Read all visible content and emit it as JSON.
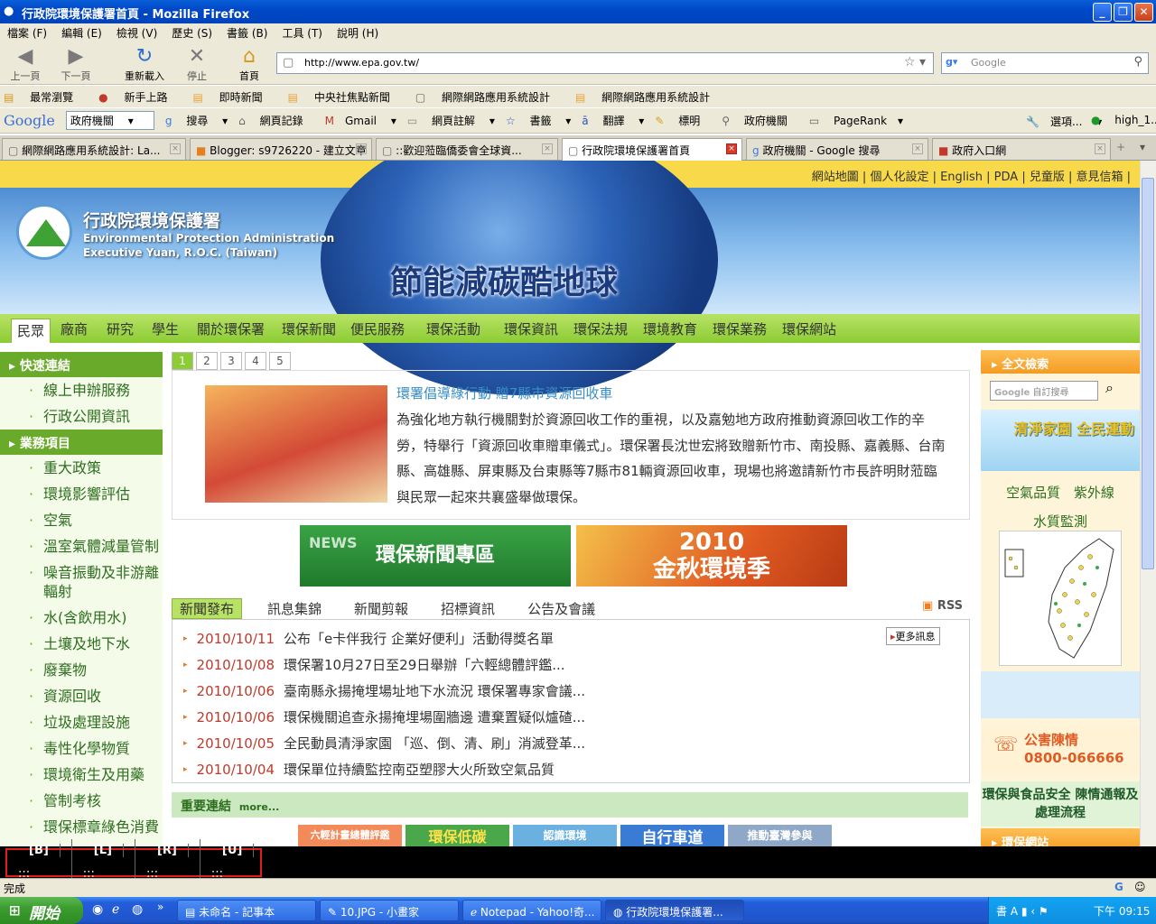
{
  "window": {
    "title": "行政院環境保護署首頁 - Mozilla Firefox"
  },
  "menu": [
    "檔案 (F)",
    "編輯 (E)",
    "檢視 (V)",
    "歷史 (S)",
    "書籤 (B)",
    "工具 (T)",
    "說明 (H)"
  ],
  "nav": {
    "back": "上一頁",
    "forward": "下一頁",
    "reload": "重新載入",
    "stop": "停止",
    "home": "首頁"
  },
  "address": {
    "url": "http://www.epa.gov.tw/"
  },
  "search": {
    "placeholder": "Google"
  },
  "bookmarks": [
    "最常瀏覽",
    "新手上路",
    "即時新聞",
    "中央社焦點新聞",
    "網際網路應用系統設計",
    "網際網路應用系統設計"
  ],
  "googlebar": {
    "logo": "Google",
    "select_value": "政府機關",
    "items": [
      "搜尋",
      "網頁記錄",
      "Gmail",
      "網頁註解",
      "書籤",
      "翻譯",
      "標明",
      "政府機關",
      "PageRank"
    ],
    "options": "選項...",
    "user": "high_1..."
  },
  "tabs": [
    {
      "label": "網際網路應用系統設計: La..."
    },
    {
      "label": "Blogger: s9726220 - 建立文章"
    },
    {
      "label": "::歡迎蒞臨僑委會全球資..."
    },
    {
      "label": "行政院環境保護署首頁"
    },
    {
      "label": "政府機關 - Google 搜尋"
    },
    {
      "label": "政府入口網"
    }
  ],
  "site": {
    "top_links": "網站地圖 | 個人化設定 | English | PDA | 兒童版 | 意見信箱 |",
    "org_zh": "行政院環境保護署",
    "org_en1": "Environmental Protection Administration",
    "org_en2": "Executive Yuan, R.O.C. (Taiwan)",
    "slogan": "節能減碳酷地球",
    "main_nav": [
      "民眾",
      "廠商",
      "研究",
      "學生",
      "關於環保署",
      "環保新聞",
      "便民服務",
      "環保活動",
      "環保資訊",
      "環保法規",
      "環境教育",
      "環保業務",
      "環保網站"
    ]
  },
  "sidebar": {
    "quick_head": "快速連結",
    "quick": [
      "線上申辦服務",
      "行政公開資訊"
    ],
    "biz_head": "業務項目",
    "biz": [
      "重大政策",
      "環境影響評估",
      "空氣",
      "溫室氣體減量管制",
      "噪音振動及非游離輻射",
      "水(含飲用水)",
      "土壤及地下水",
      "廢棄物",
      "資源回收",
      "垃圾處理設施",
      "毒性化學物質",
      "環境衛生及用藥",
      "管制考核",
      "環保標章綠色消費"
    ]
  },
  "feature": {
    "pages": [
      "1",
      "2",
      "3",
      "4",
      "5"
    ],
    "title": "環署倡導綠行動 贈7縣市資源回收車",
    "body": "為強化地方執行機關對於資源回收工作的重視，以及嘉勉地方政府推動資源回收工作的辛勞，特舉行「資源回收車贈車儀式」。環保署長沈世宏將致贈新竹市、南投縣、嘉義縣、台南縣、高雄縣、屏東縣及台東縣等7縣市81輛資源回收車，現場也將邀請新竹市長許明財蒞臨與民眾一起來共襄盛舉做環保。"
  },
  "banners": {
    "news": "環保新聞專區",
    "news_word": "NEWS",
    "autumn_year": "2010",
    "autumn": "金秋環境季"
  },
  "news": {
    "tabs": [
      "新聞發布",
      "訊息集錦",
      "新聞剪報",
      "招標資訊",
      "公告及會議"
    ],
    "rss": "RSS",
    "more": "更多訊息",
    "items": [
      {
        "date": "2010/10/11",
        "text": "公布「e卡伴我行 企業好便利」活動得獎名單"
      },
      {
        "date": "2010/10/08",
        "text": "環保署10月27日至29日舉辦「六輕總體評鑑..."
      },
      {
        "date": "2010/10/06",
        "text": "臺南縣永揚掩埋場址地下水流況 環保署專家會議..."
      },
      {
        "date": "2010/10/06",
        "text": "環保機關追查永揚掩埋場圍牆邊 遭棄置疑似爐碴..."
      },
      {
        "date": "2010/10/05",
        "text": "全民動員清淨家園 「巡、倒、清、刷」消滅登革..."
      },
      {
        "date": "2010/10/04",
        "text": "環保單位持續監控南亞塑膠大火所致空氣品質"
      }
    ]
  },
  "important": {
    "label": "重要連結",
    "more": "more..."
  },
  "promos": [
    "六輕計畫總體評鑑",
    "環保低碳",
    "認識環境",
    "自行車道",
    "推動臺灣參與"
  ],
  "right": {
    "search_head": "全文檢索",
    "search_placeholder": "自訂搜尋",
    "clean_home": "清淨家園 全民運動",
    "air": "空氣品質",
    "uv": "紫外線",
    "water": "水質監測",
    "hotline_title": "公害陳情",
    "hotline_num": "0800-066666",
    "food_safety": "環保與食品安全 陳情通報及處理流程",
    "env_sites": "環保網站"
  },
  "overlay": [
    {
      "k": "[B]",
      "v": ":::"
    },
    {
      "k": "[L]",
      "v": ":::"
    },
    {
      "k": "[R]",
      "v": ":::"
    },
    {
      "k": "[U]",
      "v": ":::"
    }
  ],
  "status": "完成",
  "taskbar": {
    "start": "開始",
    "tasks": [
      "未命名 - 記事本",
      "10.JPG - 小畫家",
      "Notepad - Yahoo!奇...",
      "行政院環境保護署..."
    ],
    "time": "下午 09:15"
  }
}
